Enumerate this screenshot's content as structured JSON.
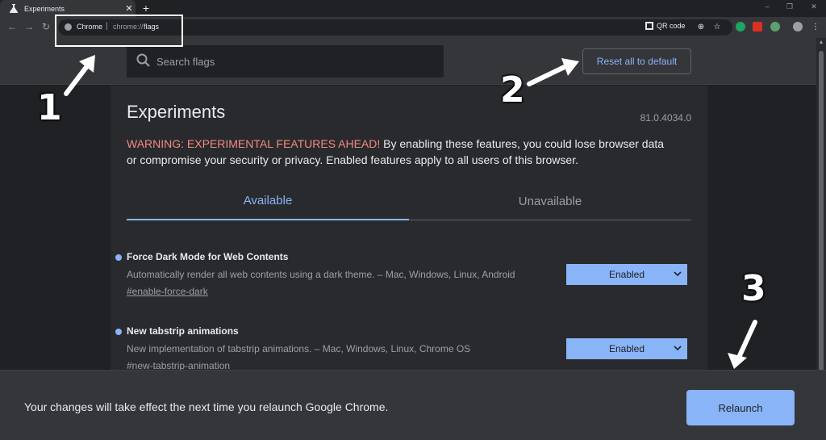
{
  "tab": {
    "title": "Experiments",
    "close": "✕",
    "new_tab": "+"
  },
  "window_controls": {
    "minimize": "–",
    "maximize": "❐",
    "close": "✕"
  },
  "toolbar": {
    "back": "←",
    "forward": "→",
    "reload": "↻",
    "omnibox_origin": "Chrome",
    "omnibox_separator": "|",
    "omnibox_scheme": "chrome://",
    "omnibox_path": "flags",
    "qr_label": "QR code",
    "zoom_icon": "⊕",
    "bookmark_icon": "☆",
    "menu_icon": "⋮"
  },
  "search": {
    "placeholder": "Search flags"
  },
  "reset_button": "Reset all to default",
  "page": {
    "title": "Experiments",
    "version": "81.0.4034.0",
    "warning_heading": "WARNING: EXPERIMENTAL FEATURES AHEAD!",
    "warning_body": " By enabling these features, you could lose browser data or compromise your security or privacy. Enabled features apply to all users of this browser.",
    "tabs": [
      {
        "label": "Available",
        "active": true
      },
      {
        "label": "Unavailable",
        "active": false
      }
    ]
  },
  "flags": [
    {
      "name": "Force Dark Mode for Web Contents",
      "description": "Automatically render all web contents using a dark theme. – Mac, Windows, Linux, Android",
      "link": "#enable-force-dark",
      "value": "Enabled"
    },
    {
      "name": "New tabstrip animations",
      "description": "New implementation of tabstrip animations. – Mac, Windows, Linux, Chrome OS",
      "link": "#new-tabstrip-animation",
      "value": "Enabled"
    }
  ],
  "relaunch": {
    "message": "Your changes will take effect the next time you relaunch Google Chrome.",
    "button": "Relaunch"
  },
  "annotations": {
    "step1": "1",
    "step2": "2",
    "step3": "3"
  },
  "colors": {
    "accent": "#8ab4f8",
    "warning": "#f28b82",
    "background": "#202124",
    "panel": "#292a2d"
  }
}
